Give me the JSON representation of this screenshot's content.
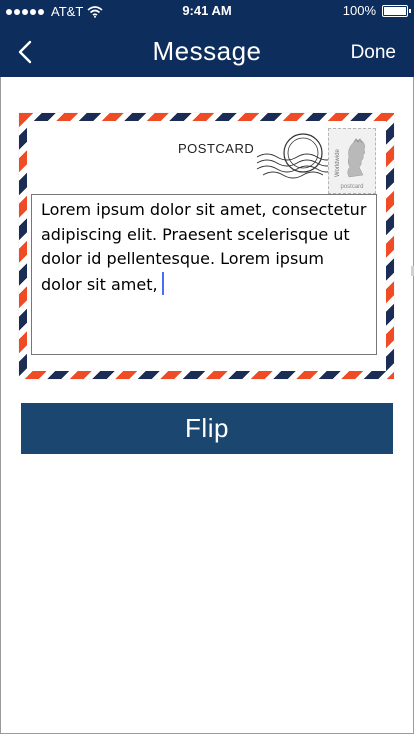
{
  "status_bar": {
    "carrier": "AT&T",
    "time": "9:41 AM",
    "battery": "100%"
  },
  "nav": {
    "title": "Message",
    "done_label": "Done"
  },
  "postcard": {
    "label": "POSTCARD",
    "stamp": {
      "vertical_text": "Worldwide",
      "caption": "postcard"
    },
    "message": "Lorem ipsum dolor sit amet, consectetur adipiscing elit. Praesent scelerisque ut dolor id pellentesque. Lorem ipsum dolor sit amet,"
  },
  "flip_button": {
    "label": "Flip"
  },
  "colors": {
    "header": "#0d2d5c",
    "flip": "#1a466f",
    "stripe_red": "#ef4b25",
    "stripe_navy": "#1b2d55"
  }
}
